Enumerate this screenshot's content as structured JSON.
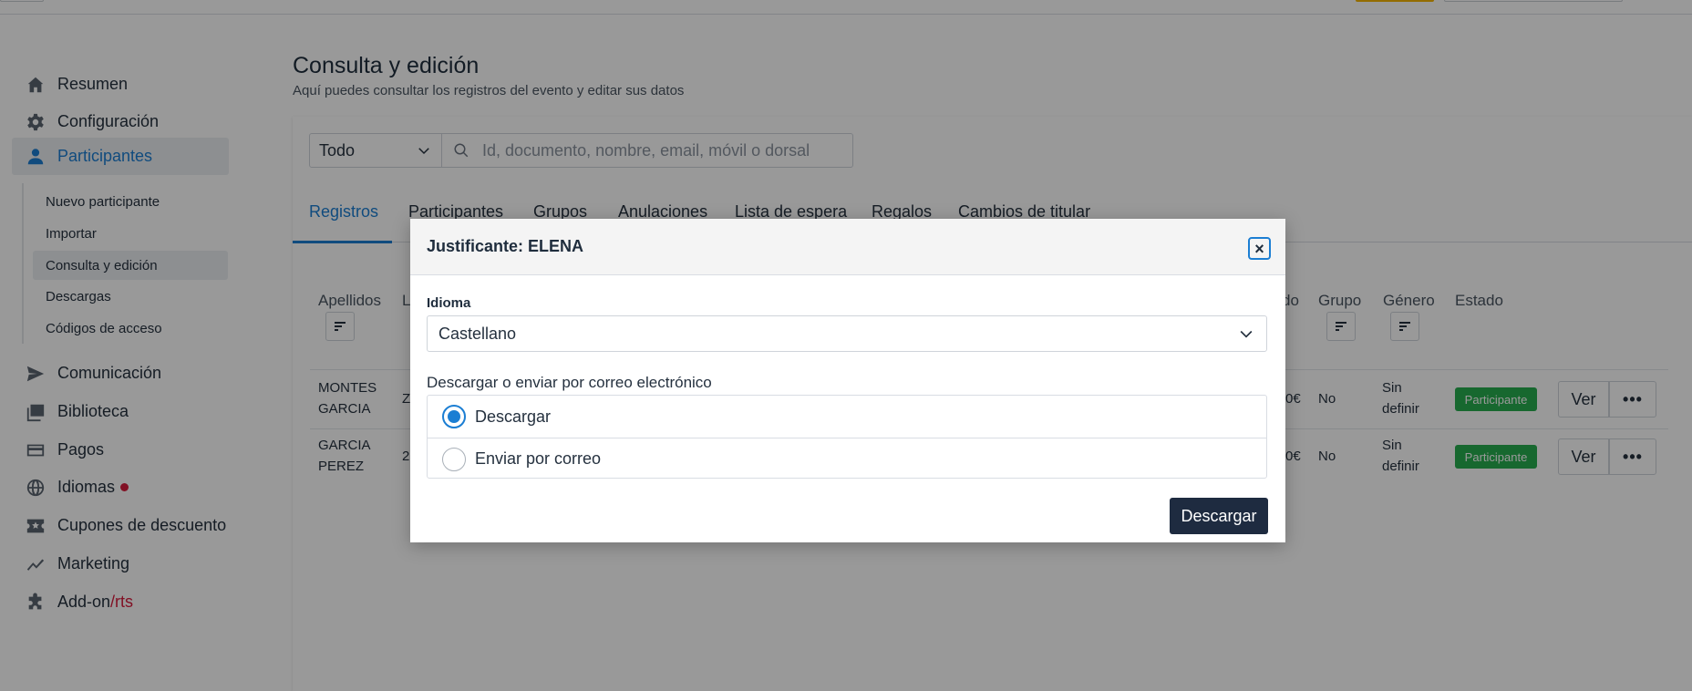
{
  "sidebar": {
    "items": [
      {
        "label": "Resumen",
        "icon": "home-icon"
      },
      {
        "label": "Configuración",
        "icon": "gear-icon"
      },
      {
        "label": "Participantes",
        "icon": "person-icon"
      },
      {
        "label": "Comunicación",
        "icon": "send-icon"
      },
      {
        "label": "Biblioteca",
        "icon": "images-icon"
      },
      {
        "label": "Pagos",
        "icon": "card-icon"
      },
      {
        "label": "Idiomas",
        "icon": "globe-icon"
      },
      {
        "label": "Cupones de descuento",
        "icon": "coupon-icon"
      },
      {
        "label": "Marketing",
        "icon": "trend-icon"
      },
      {
        "label": "Add-on",
        "label_suffix": "/rts",
        "icon": "puzzle-icon"
      }
    ],
    "sub_items": [
      "Nuevo participante",
      "Importar",
      "Consulta y edición",
      "Descargas",
      "Códigos de acceso"
    ],
    "active_item": "Participantes",
    "active_sub_item": "Consulta y edición"
  },
  "page": {
    "title": "Consulta y edición",
    "subtitle": "Aquí puedes consultar los registros del evento y editar sus datos"
  },
  "filter": {
    "select_value": "Todo",
    "search_placeholder": "Id, documento, nombre, email, móvil o dorsal"
  },
  "tabs": [
    "Registros",
    "Participantes",
    "Grupos",
    "Anulaciones",
    "Lista de espera",
    "Regalos",
    "Cambios de titular"
  ],
  "active_tab": "Registros",
  "table": {
    "headers": {
      "apellidos": "Apellidos",
      "l": "L",
      "do": "do",
      "grupo": "Grupo",
      "genero": "Género",
      "estado": "Estado"
    },
    "rows": [
      {
        "apellidos_1": "MONTES",
        "apellidos_2": "GARCIA",
        "l": "Z",
        "price": "0€",
        "grupo": "No",
        "genero_1": "Sin",
        "genero_2": "definir",
        "estado": "Participante",
        "ver": "Ver",
        "more": "•••"
      },
      {
        "apellidos_1": "GARCIA",
        "apellidos_2": "PEREZ",
        "l": "2",
        "price": "0€",
        "grupo": "No",
        "genero_1": "Sin",
        "genero_2": "definir",
        "estado": "Participante",
        "ver": "Ver",
        "more": "•••"
      }
    ]
  },
  "modal": {
    "title": "Justificante: ELENA",
    "close": "×",
    "language_label": "Idioma",
    "language_value": "Castellano",
    "mode_label": "Descargar o enviar por correo electrónico",
    "options": [
      {
        "label": "Descargar",
        "selected": true
      },
      {
        "label": "Enviar por correo",
        "selected": false
      }
    ],
    "submit": "Descargar"
  },
  "colors": {
    "accent": "#1b7ed3",
    "badge": "#27ae4f",
    "primary_button": "#1e2b40",
    "alert_dot": "#d81b3c"
  }
}
